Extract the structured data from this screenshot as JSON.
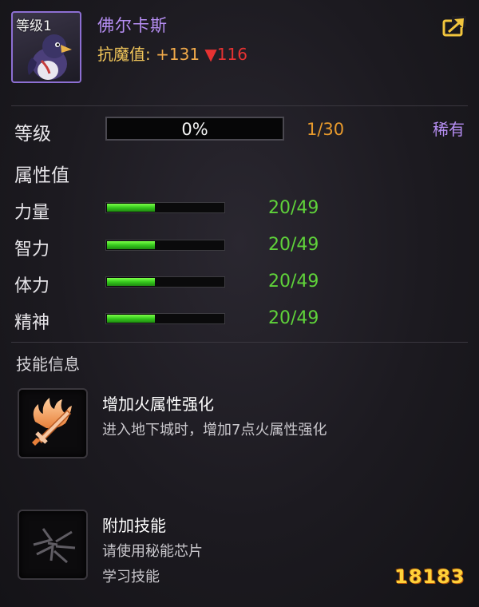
{
  "hero": {
    "portrait_level": "等级1",
    "name": "佛尔卡斯",
    "resist_label": "抗魔值:",
    "resist_plus": "+131",
    "resist_down": "▼116"
  },
  "level": {
    "label": "等级",
    "progress_text": "0%",
    "progress_fraction": 0,
    "count": "1/30",
    "rarity": "稀有"
  },
  "attributes": {
    "header": "属性值",
    "items": [
      {
        "name": "力量",
        "value": "20/49",
        "fraction": 0.408
      },
      {
        "name": "智力",
        "value": "20/49",
        "fraction": 0.408
      },
      {
        "name": "体力",
        "value": "20/49",
        "fraction": 0.408
      },
      {
        "name": "精神",
        "value": "20/49",
        "fraction": 0.408
      }
    ]
  },
  "skills": {
    "header": "技能信息",
    "items": [
      {
        "icon": "flame-sword-icon",
        "title": "增加火属性强化",
        "desc": [
          "进入地下城时，增加7点火属性强化"
        ]
      },
      {
        "icon": "locked-skill-icon",
        "title": "附加技能",
        "desc": [
          "请使用秘能芯片",
          "学习技能"
        ]
      }
    ]
  },
  "watermark": "18183",
  "colors": {
    "rarity_purple": "#b68ef3",
    "stat_green": "#5fd23a",
    "level_orange": "#e89a2c",
    "resist_red": "#e63232"
  }
}
